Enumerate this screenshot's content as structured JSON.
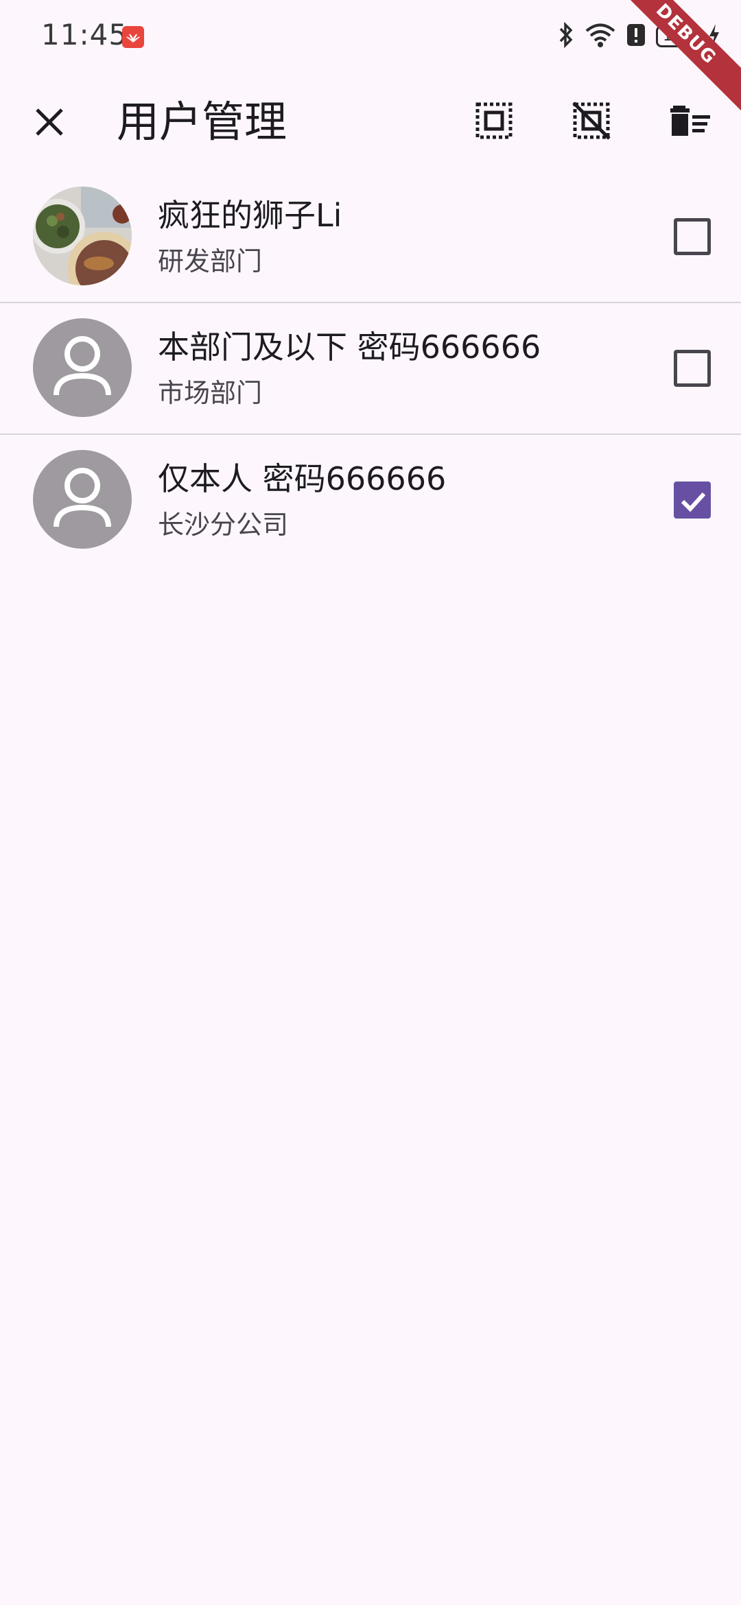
{
  "status_bar": {
    "time": "11:45",
    "battery": "100"
  },
  "debug_banner": "DEBUG",
  "app_bar": {
    "title": "用户管理",
    "actions": [
      {
        "icon": "select-all-icon"
      },
      {
        "icon": "deselect-icon"
      },
      {
        "icon": "delete-sweep-icon"
      }
    ]
  },
  "users": [
    {
      "name": "疯狂的狮子Li",
      "dept": "研发部门",
      "avatar": "photo",
      "checked": false
    },
    {
      "name": "本部门及以下 密码666666",
      "dept": "市场部门",
      "avatar": "default",
      "checked": false
    },
    {
      "name": "仅本人 密码666666",
      "dept": "长沙分公司",
      "avatar": "default",
      "checked": true
    }
  ],
  "colors": {
    "background": "#fdf7fd",
    "accent": "#6750a4",
    "avatar_default": "#9e9a9f"
  }
}
